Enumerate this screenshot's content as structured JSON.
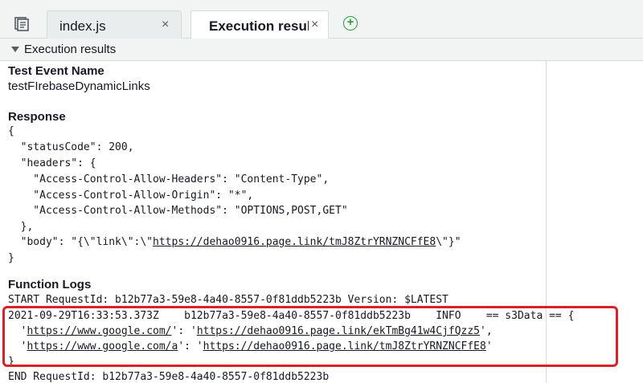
{
  "tabs": [
    {
      "label": "index.js",
      "close": "×"
    },
    {
      "label": "Execution results",
      "close": "×"
    }
  ],
  "add_tab": "+",
  "section": {
    "title": "Execution results"
  },
  "test_event": {
    "heading": "Test Event Name",
    "value": "testFIrebaseDynamicLinks"
  },
  "response": {
    "heading": "Response",
    "lines": [
      {
        "text": "{"
      },
      {
        "text": "  \"statusCode\": 200,"
      },
      {
        "text": "  \"headers\": {"
      },
      {
        "text": "    \"Access-Control-Allow-Headers\": \"Content-Type\","
      },
      {
        "text": "    \"Access-Control-Allow-Origin\": \"*\","
      },
      {
        "text": "    \"Access-Control-Allow-Methods\": \"OPTIONS,POST,GET\""
      },
      {
        "text": "  },"
      },
      {
        "pre": "  \"body\": \"{\\\"link\\\":\\\"",
        "link": "https://dehao0916.page.link/tmJ8ZtrYRNZNCFfE8",
        "post": "\\\"}\""
      },
      {
        "text": "}"
      }
    ]
  },
  "logs": {
    "heading": "Function Logs",
    "start": "START RequestId: b12b77a3-59e8-4a40-8557-0f81ddb5223b Version: $LATEST",
    "entry": "2021-09-29T16:33:53.373Z    b12b77a3-59e8-4a40-8557-0f81ddb5223b    INFO    == s3Data == {",
    "items": [
      {
        "pre": "  '",
        "key": "https://www.google.com/",
        "mid": "': '",
        "val": "https://dehao0916.page.link/ekTmBg41w4CjfQzz5",
        "post": "',"
      },
      {
        "pre": "  '",
        "key": "https://www.google.com/a",
        "mid": "': '",
        "val": "https://dehao0916.page.link/tmJ8ZtrYRNZNCFfE8",
        "post": "'"
      }
    ],
    "close": "}",
    "end": "END RequestId: b12b77a3-59e8-4a40-8557-0f81ddb5223b"
  },
  "colors": {
    "highlight": "#d9212a",
    "accent": "#ec7211",
    "add": "#2e9e3e"
  }
}
